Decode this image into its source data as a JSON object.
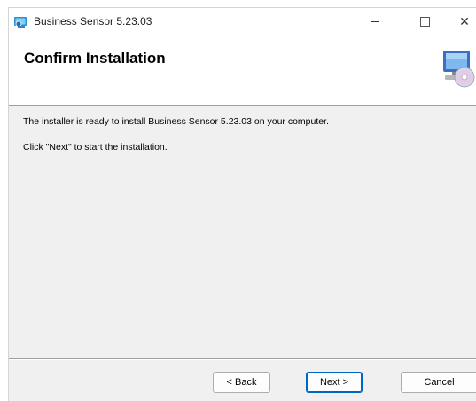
{
  "window": {
    "title": "Business Sensor 5.23.03",
    "controls": {
      "minimize": "—",
      "maximize": "☐",
      "close": "✕"
    }
  },
  "header": {
    "title": "Confirm Installation",
    "graphic_icon": "computer-with-cd-icon"
  },
  "body": {
    "line1": "The installer is ready to install Business Sensor 5.23.03 on your computer.",
    "line2": "Click \"Next\" to start the installation."
  },
  "buttons": {
    "back": "< Back",
    "next": "Next >",
    "cancel": "Cancel"
  },
  "colors": {
    "window_bg": "#f0f0f0",
    "header_bg": "#ffffff",
    "default_button_border": "#0067c0"
  }
}
